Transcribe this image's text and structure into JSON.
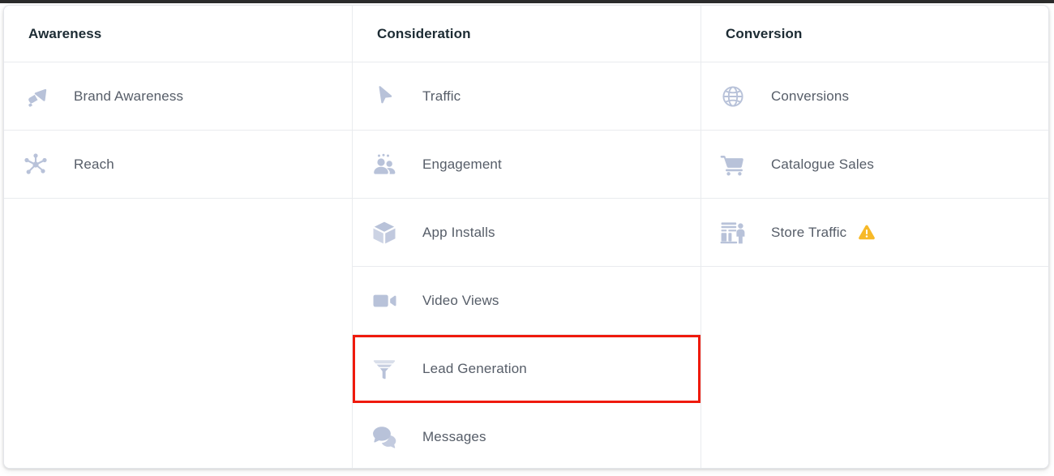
{
  "card": {
    "columns": [
      {
        "id": "awareness",
        "header": "Awareness",
        "items": [
          {
            "label": "Brand Awareness",
            "icon": "megaphone-icon",
            "warning": false
          },
          {
            "label": "Reach",
            "icon": "reach-nodes-icon",
            "warning": false
          }
        ]
      },
      {
        "id": "consideration",
        "header": "Consideration",
        "items": [
          {
            "label": "Traffic",
            "icon": "cursor-arrow-icon",
            "warning": false
          },
          {
            "label": "Engagement",
            "icon": "people-group-icon",
            "warning": false
          },
          {
            "label": "App Installs",
            "icon": "cube-box-icon",
            "warning": false
          },
          {
            "label": "Video Views",
            "icon": "video-camera-icon",
            "warning": false
          },
          {
            "label": "Lead Generation",
            "icon": "funnel-icon",
            "warning": false,
            "selected": true
          },
          {
            "label": "Messages",
            "icon": "chat-bubbles-icon",
            "warning": false
          }
        ]
      },
      {
        "id": "conversion",
        "header": "Conversion",
        "items": [
          {
            "label": "Conversions",
            "icon": "globe-icon",
            "warning": false
          },
          {
            "label": "Catalogue Sales",
            "icon": "shopping-cart-icon",
            "warning": false
          },
          {
            "label": "Store Traffic",
            "icon": "storefront-icon",
            "warning": true
          }
        ]
      }
    ],
    "colors": {
      "header_text": "#1C2B33",
      "label_text": "#565D68",
      "icon": "#B8C2D9",
      "divider": "#E9EBEE",
      "selection_outline": "#EF1A0C",
      "warning": "#F7B928",
      "card_background": "#FFFFFF"
    },
    "selection": {
      "column": "consideration",
      "item": "Lead Generation"
    },
    "warning_icon_name": "warning-triangle-icon"
  }
}
